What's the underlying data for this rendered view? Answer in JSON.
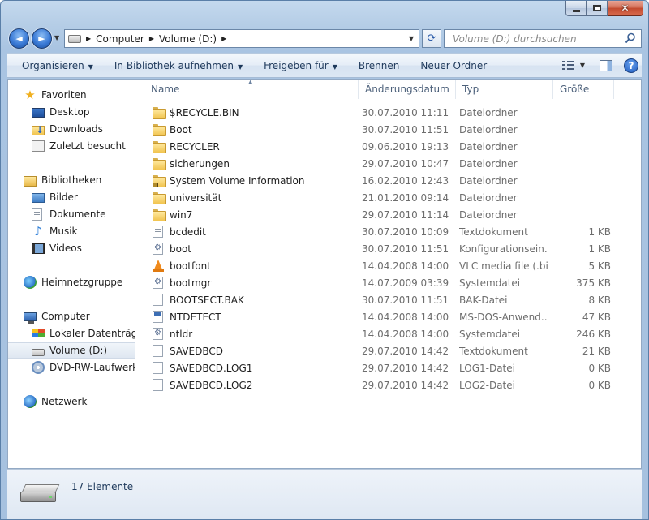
{
  "window": {
    "controls": {
      "minimize": "–",
      "maximize": "□",
      "close": "✕"
    }
  },
  "navigation": {
    "back_icon": "◄",
    "forward_icon": "►",
    "breadcrumb": [
      "Computer",
      "Volume (D:)"
    ],
    "search_placeholder": "Volume (D:) durchsuchen"
  },
  "toolbar": {
    "organize": "Organisieren",
    "include_library": "In Bibliothek aufnehmen",
    "share": "Freigeben für",
    "burn": "Brennen",
    "new_folder": "Neuer Ordner",
    "help": "?"
  },
  "sidebar": {
    "favorites": {
      "label": "Favoriten",
      "items": [
        {
          "label": "Desktop",
          "icon": "desktop-icon"
        },
        {
          "label": "Downloads",
          "icon": "downloads-icon"
        },
        {
          "label": "Zuletzt besucht",
          "icon": "recent-places-icon"
        }
      ]
    },
    "libraries": {
      "label": "Bibliotheken",
      "items": [
        {
          "label": "Bilder",
          "icon": "pictures-icon"
        },
        {
          "label": "Dokumente",
          "icon": "documents-icon"
        },
        {
          "label": "Musik",
          "icon": "music-icon"
        },
        {
          "label": "Videos",
          "icon": "videos-icon"
        }
      ]
    },
    "homegroup": {
      "label": "Heimnetzgruppe"
    },
    "computer": {
      "label": "Computer",
      "items": [
        {
          "label": "Lokaler Datenträger (C:)",
          "icon": "local-disk-icon"
        },
        {
          "label": "Volume (D:)",
          "icon": "drive-icon",
          "selected": true
        },
        {
          "label": "DVD-RW-Laufwerk (E:)",
          "icon": "dvd-drive-icon"
        }
      ]
    },
    "network": {
      "label": "Netzwerk"
    }
  },
  "filelist": {
    "columns": {
      "name": "Name",
      "date": "Änderungsdatum",
      "type": "Typ",
      "size": "Größe"
    },
    "rows": [
      {
        "name": "$RECYCLE.BIN",
        "date": "30.07.2010 11:11",
        "type": "Dateiordner",
        "size": "",
        "icon": "folder"
      },
      {
        "name": "Boot",
        "date": "30.07.2010 11:51",
        "type": "Dateiordner",
        "size": "",
        "icon": "folder"
      },
      {
        "name": "RECYCLER",
        "date": "09.06.2010 19:13",
        "type": "Dateiordner",
        "size": "",
        "icon": "folder"
      },
      {
        "name": "sicherungen",
        "date": "29.07.2010 10:47",
        "type": "Dateiordner",
        "size": "",
        "icon": "folder"
      },
      {
        "name": "System Volume Information",
        "date": "16.02.2010 12:43",
        "type": "Dateiordner",
        "size": "",
        "icon": "folder-locked"
      },
      {
        "name": "universität",
        "date": "21.01.2010 09:14",
        "type": "Dateiordner",
        "size": "",
        "icon": "folder"
      },
      {
        "name": "win7",
        "date": "29.07.2010 11:14",
        "type": "Dateiordner",
        "size": "",
        "icon": "folder"
      },
      {
        "name": "bcdedit",
        "date": "30.07.2010 10:09",
        "type": "Textdokument",
        "size": "1 KB",
        "icon": "text"
      },
      {
        "name": "boot",
        "date": "30.07.2010 11:51",
        "type": "Konfigurationsein...",
        "size": "1 KB",
        "icon": "config"
      },
      {
        "name": "bootfont",
        "date": "14.04.2008 14:00",
        "type": "VLC media file (.bi...",
        "size": "5 KB",
        "icon": "vlc"
      },
      {
        "name": "bootmgr",
        "date": "14.07.2009 03:39",
        "type": "Systemdatei",
        "size": "375 KB",
        "icon": "config"
      },
      {
        "name": "BOOTSECT.BAK",
        "date": "30.07.2010 11:51",
        "type": "BAK-Datei",
        "size": "8 KB",
        "icon": "blank"
      },
      {
        "name": "NTDETECT",
        "date": "14.04.2008 14:00",
        "type": "MS-DOS-Anwend...",
        "size": "47 KB",
        "icon": "exe"
      },
      {
        "name": "ntldr",
        "date": "14.04.2008 14:00",
        "type": "Systemdatei",
        "size": "246 KB",
        "icon": "config"
      },
      {
        "name": "SAVEDBCD",
        "date": "29.07.2010 14:42",
        "type": "Textdokument",
        "size": "21 KB",
        "icon": "blank"
      },
      {
        "name": "SAVEDBCD.LOG1",
        "date": "29.07.2010 14:42",
        "type": "LOG1-Datei",
        "size": "0 KB",
        "icon": "blank"
      },
      {
        "name": "SAVEDBCD.LOG2",
        "date": "29.07.2010 14:42",
        "type": "LOG2-Datei",
        "size": "0 KB",
        "icon": "blank"
      }
    ]
  },
  "details": {
    "count": "17 Elemente"
  }
}
